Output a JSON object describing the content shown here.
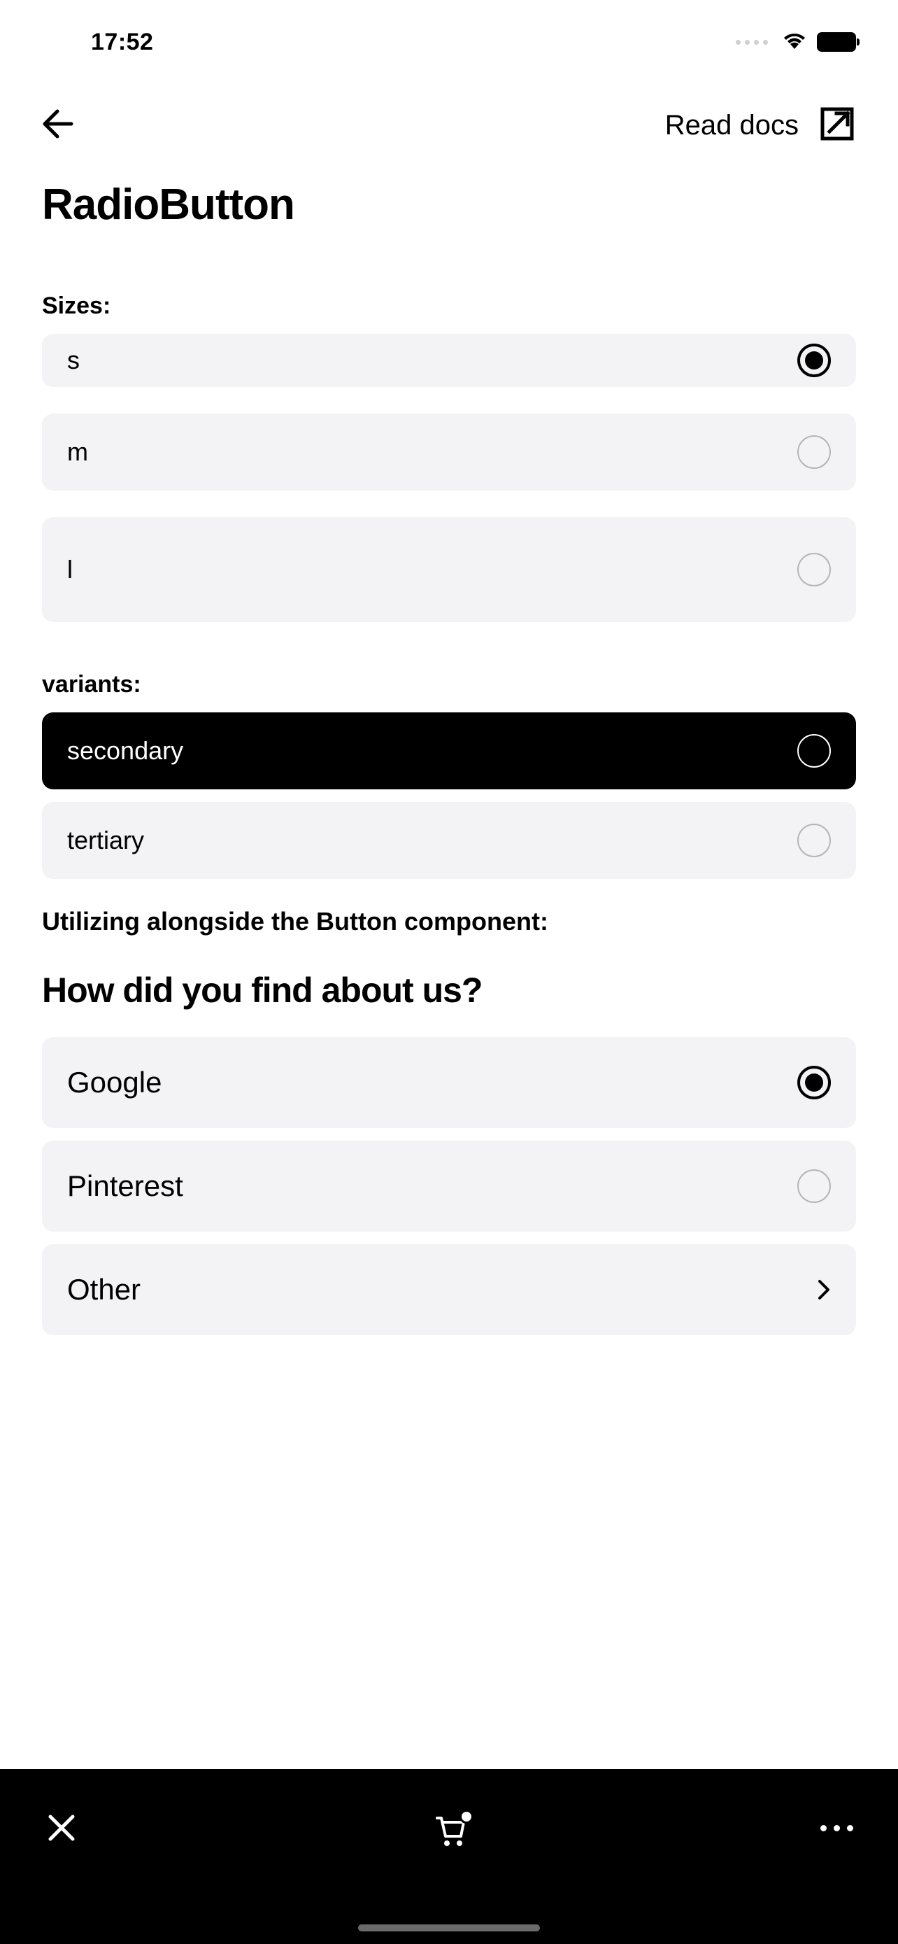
{
  "status": {
    "time": "17:52"
  },
  "nav": {
    "docs_label": "Read docs"
  },
  "page": {
    "title": "RadioButton"
  },
  "sizes": {
    "label": "Sizes:",
    "items": [
      {
        "label": "s",
        "selected": true
      },
      {
        "label": "m",
        "selected": false
      },
      {
        "label": "l",
        "selected": false
      }
    ]
  },
  "variants": {
    "label": "variants:",
    "items": [
      {
        "label": "secondary",
        "dark": true,
        "selected": false
      },
      {
        "label": "tertiary",
        "dark": false,
        "selected": false
      }
    ]
  },
  "usage": {
    "label": "Utilizing alongside the Button component:",
    "question": "How did you find about us?",
    "items": [
      {
        "label": "Google",
        "type": "radio",
        "selected": true
      },
      {
        "label": "Pinterest",
        "type": "radio",
        "selected": false
      },
      {
        "label": "Other",
        "type": "chevron"
      }
    ]
  }
}
